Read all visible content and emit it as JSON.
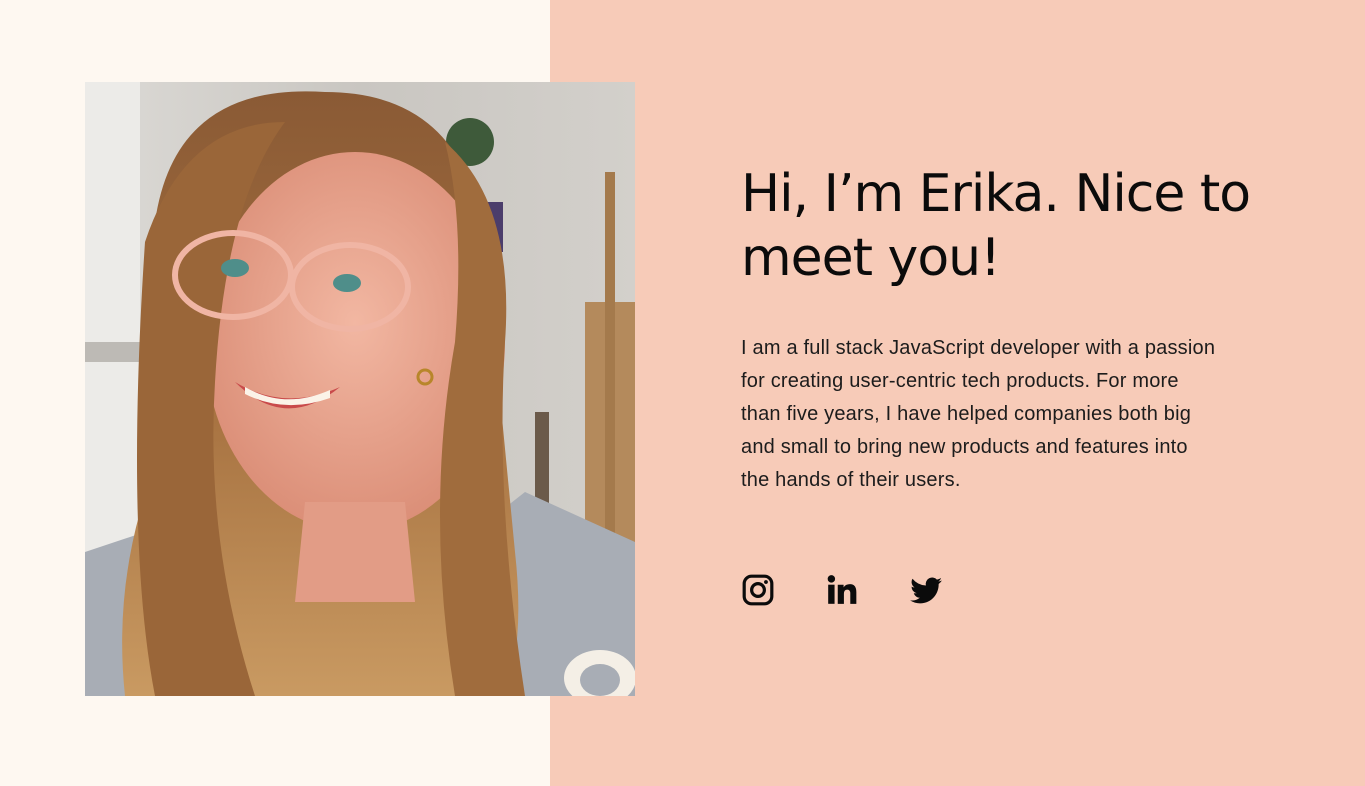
{
  "hero": {
    "heading": "Hi, I’m Erika. Nice to meet you!",
    "bio": "I am a full stack JavaScript developer with a passion for creating user-centric tech products. For more than five years, I have helped companies both big and small to bring new products and features into the hands of their users.",
    "colors": {
      "left_background": "#fef8f1",
      "right_background": "#f7cbb8",
      "text": "#0b0b0b"
    }
  },
  "social": {
    "links": [
      {
        "name": "instagram",
        "icon": "instagram-icon"
      },
      {
        "name": "linkedin",
        "icon": "linkedin-icon"
      },
      {
        "name": "twitter",
        "icon": "twitter-icon"
      }
    ]
  }
}
